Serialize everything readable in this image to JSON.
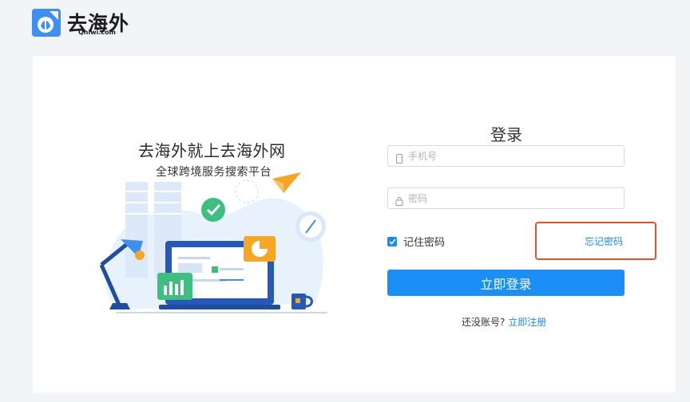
{
  "brand": {
    "name": "去海外",
    "domain": "Qhiwi.com",
    "color": "#3f8ff0"
  },
  "slogan": {
    "title": "去海外就上去海外网",
    "subtitle": "全球跨境服务搜索平台"
  },
  "login": {
    "title": "登录",
    "phone_placeholder": "手机号",
    "password_placeholder": "密码",
    "remember_label": "记住密码",
    "remember_checked": true,
    "forgot_label": "忘记密码",
    "submit_label": "立即登录",
    "register_prompt": "还没账号?",
    "register_link": "立即注册"
  },
  "colors": {
    "accent": "#1b8ff5",
    "highlight_border": "#e8502a",
    "background": "#f3f4f6"
  }
}
